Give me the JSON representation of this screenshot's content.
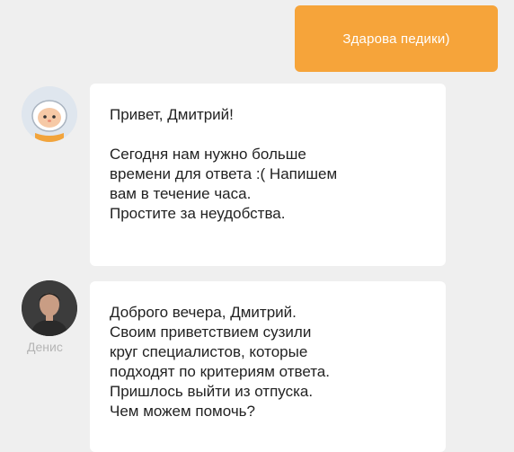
{
  "outgoing_message": {
    "text": "Здарова педики)"
  },
  "bot_message": {
    "lines": [
      "Привет, Дмитрий!",
      "",
      "Сегодня нам нужно больше",
      "времени для ответа :( Напишем",
      "вам в течение часа.",
      "Простите за неудобства."
    ]
  },
  "agent_message": {
    "name": "Денис",
    "lines": [
      "Доброго вечера, Дмитрий.",
      "Своим приветствием сузили",
      "круг специалистов, которые",
      "подходят по критериям ответа.",
      "Пришлось выйти из отпуска.",
      "Чем можем помочь?"
    ]
  },
  "colors": {
    "outgoing_bubble": "#f6a43a",
    "background": "#efefef",
    "incoming_bubble": "#ffffff",
    "agent_name": "#b5b5b5"
  }
}
